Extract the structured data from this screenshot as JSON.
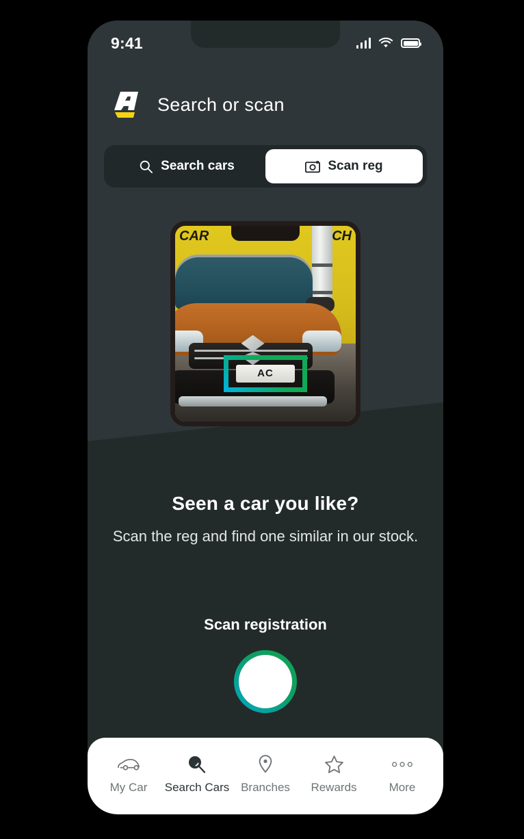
{
  "status_bar": {
    "time": "9:41",
    "icons": [
      "signal-icon",
      "wifi-icon",
      "battery-icon"
    ]
  },
  "header": {
    "logo": "arnold-clark-logo",
    "title": "Search or scan"
  },
  "segmented_control": {
    "tabs": [
      {
        "label": "Search cars",
        "icon": "search-icon",
        "active": false
      },
      {
        "label": "Scan reg",
        "icon": "camera-icon",
        "active": true
      }
    ]
  },
  "illustration": {
    "name": "phone-camera-mockup",
    "plate_text": "AC",
    "banner_left": "CAR",
    "banner_right": "CH"
  },
  "copy": {
    "heading": "Seen a car you like?",
    "body": "Scan the reg and find one similar in our stock."
  },
  "scan": {
    "label": "Scan registration",
    "button": "shutter-button"
  },
  "tabbar": {
    "items": [
      {
        "label": "My Car",
        "icon": "car-icon",
        "active": false
      },
      {
        "label": "Search Cars",
        "icon": "search-icon",
        "active": true
      },
      {
        "label": "Branches",
        "icon": "location-pin-icon",
        "active": false
      },
      {
        "label": "Rewards",
        "icon": "star-icon",
        "active": false
      },
      {
        "label": "More",
        "icon": "ellipsis-icon",
        "active": false
      }
    ]
  },
  "colors": {
    "bg_top": "#2E3639",
    "bg_bottom": "#232B2A",
    "segment_track": "#20282A",
    "accent_green": "#12A24F",
    "accent_cyan": "#00A8C9",
    "logo_yellow": "#F5D312",
    "nav_bg": "#FFFFFF",
    "nav_active": "#2B3336",
    "nav_inactive": "#6E7477"
  }
}
